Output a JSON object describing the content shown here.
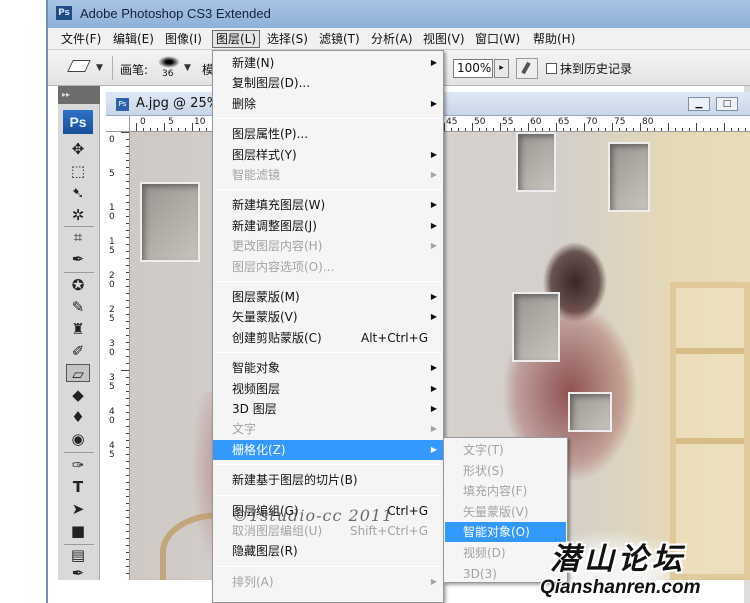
{
  "window": {
    "title": "Adobe Photoshop CS3 Extended",
    "app_badge": "Ps"
  },
  "menubar": [
    {
      "label": "文件(F)"
    },
    {
      "label": "编辑(E)"
    },
    {
      "label": "图像(I)"
    },
    {
      "label": "图层(L)",
      "active": true
    },
    {
      "label": "选择(S)"
    },
    {
      "label": "滤镜(T)"
    },
    {
      "label": "分析(A)"
    },
    {
      "label": "视图(V)"
    },
    {
      "label": "窗口(W)"
    },
    {
      "label": "帮助(H)"
    }
  ],
  "options": {
    "brush_label": "画笔:",
    "brush_size": "36",
    "mode_label_partial": "模",
    "flow_value": "100%",
    "erase_history_label": "抹到历史记录"
  },
  "toolbox": {
    "badge": "Ps",
    "collapse": "▸▸"
  },
  "document": {
    "title": "A.jpg @ 25%"
  },
  "rulers": {
    "h": [
      "0",
      "5",
      "10",
      "45",
      "50",
      "55",
      "60",
      "65",
      "70",
      "75",
      "80"
    ],
    "v": [
      "0",
      "5",
      "1 0",
      "1 5",
      "2 0",
      "2 5",
      "3 0",
      "3 5",
      "4 0",
      "4 5"
    ]
  },
  "layer_menu": {
    "items": [
      {
        "label": "新建(N)",
        "submenu": true
      },
      {
        "label": "复制图层(D)..."
      },
      {
        "label": "删除",
        "submenu": true
      },
      {
        "sep": true
      },
      {
        "label": "图层属性(P)..."
      },
      {
        "label": "图层样式(Y)",
        "submenu": true
      },
      {
        "label": "智能滤镜",
        "submenu": true,
        "disabled": true
      },
      {
        "sep": true
      },
      {
        "label": "新建填充图层(W)",
        "submenu": true
      },
      {
        "label": "新建调整图层(J)",
        "submenu": true
      },
      {
        "label": "更改图层内容(H)",
        "submenu": true,
        "disabled": true
      },
      {
        "label": "图层内容选项(O)...",
        "disabled": true
      },
      {
        "sep": true
      },
      {
        "label": "图层蒙版(M)",
        "submenu": true
      },
      {
        "label": "矢量蒙版(V)",
        "submenu": true
      },
      {
        "label": "创建剪贴蒙版(C)",
        "shortcut": "Alt+Ctrl+G"
      },
      {
        "sep": true
      },
      {
        "label": "智能对象",
        "submenu": true
      },
      {
        "label": "视频图层",
        "submenu": true
      },
      {
        "label": "3D 图层",
        "submenu": true
      },
      {
        "label": "文字",
        "submenu": true,
        "disabled": true
      },
      {
        "label": "栅格化(Z)",
        "submenu": true,
        "highlighted": true
      },
      {
        "sep": true
      },
      {
        "label": "新建基于图层的切片(B)"
      },
      {
        "sep": true
      },
      {
        "label": "图层编组(G)",
        "shortcut": "Ctrl+G"
      },
      {
        "label": "取消图层编组(U)",
        "shortcut": "Shift+Ctrl+G",
        "disabled": true
      },
      {
        "label": "隐藏图层(R)"
      },
      {
        "sep": true
      },
      {
        "label": "排列(A)",
        "submenu": true,
        "disabled": true
      }
    ]
  },
  "rasterize_submenu": {
    "items": [
      {
        "label": "文字(T)",
        "disabled": true
      },
      {
        "label": "形状(S)",
        "disabled": true
      },
      {
        "label": "填充内容(F)",
        "disabled": true
      },
      {
        "label": "矢量蒙版(V)",
        "disabled": true
      },
      {
        "label": "智能对象(O)",
        "highlighted": true
      },
      {
        "label": "视频(D)",
        "disabled": true
      },
      {
        "label": "3D(3)",
        "disabled": true
      }
    ]
  },
  "watermarks": {
    "studio": "©1studio-cc 2011",
    "brand_cn": "潜山论坛",
    "brand_url": "Qianshanren.com"
  }
}
